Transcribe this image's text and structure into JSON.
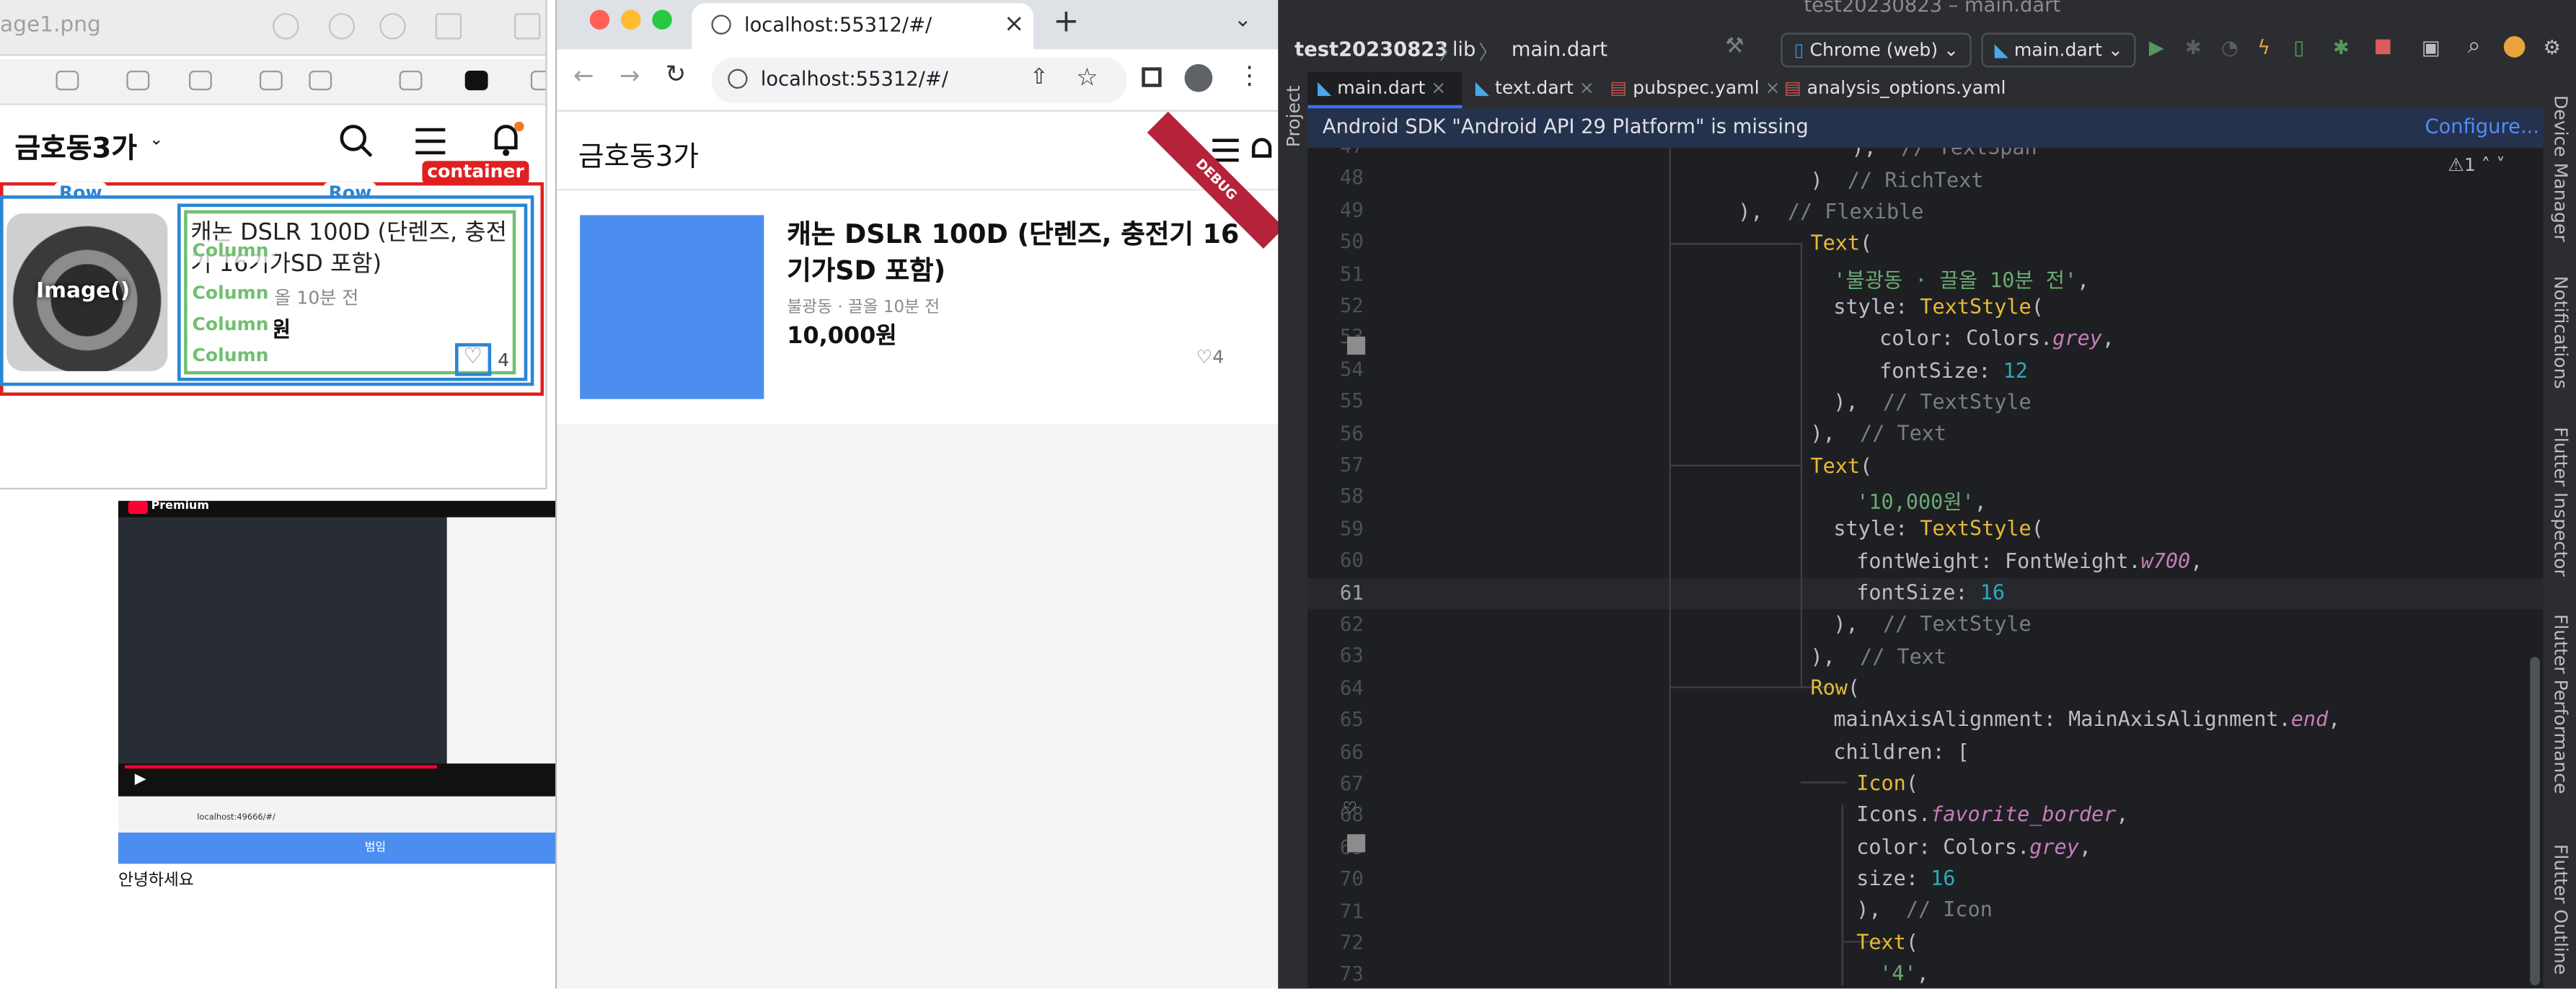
{
  "preview": {
    "filename": "age1.png",
    "app": {
      "title": "금호동3가",
      "product_title": "캐논 DSLR 100D (단렌즈, 충전기 16기가SD 포함)",
      "meta": "불광동 · 끌올 10분 전",
      "price": "원",
      "likes": "4"
    },
    "labels": {
      "container": "container",
      "row1": "Row",
      "row2": "Row",
      "image": "Image()",
      "column": "Column"
    }
  },
  "youtube": {
    "brand": "Premium",
    "greeting": "안녕하세요",
    "button": "범임",
    "url": "localhost:49666/#/"
  },
  "chrome": {
    "tab_title": "localhost:55312/#/",
    "url": "localhost:55312/#/",
    "app": {
      "title": "금호동3가",
      "product_title": "캐논 DSLR 100D (단렌즈, 충전기 16기가SD 포함)",
      "meta": "불광동 · 끌올 10분 전",
      "price": "10,000원",
      "likes": "4"
    },
    "debug_banner": "DEBUG"
  },
  "ide": {
    "window_title": "test20230823 – main.dart",
    "breadcrumb": [
      "test20230823",
      "lib",
      "main.dart"
    ],
    "device": "Chrome (web)",
    "run_config": "main.dart",
    "tabs": [
      "main.dart",
      "text.dart",
      "pubspec.yaml",
      "analysis_options.yaml"
    ],
    "notice": "Android SDK \"Android API 29 Platform\" is missing",
    "notice_action": "Configure...",
    "problems": "1",
    "right_tools": [
      "Device Manager",
      "Notifications",
      "Flutter Inspector",
      "Flutter Performance",
      "Flutter Outline"
    ],
    "left_tools": [
      "Project"
    ],
    "current_line": 61,
    "line_numbers": [
      "47",
      "48",
      "49",
      "50",
      "51",
      "52",
      "53",
      "54",
      "55",
      "56",
      "57",
      "58",
      "59",
      "60",
      "61",
      "62",
      "63",
      "64",
      "65",
      "66",
      "67",
      "68",
      "69",
      "70",
      "71",
      "72",
      "73"
    ]
  },
  "colors": {
    "accent_blue": "#4b8ef0",
    "debug_red": "#b5223a",
    "ide_bg": "#1e1f22",
    "annot_red": "#e02020",
    "annot_blue": "#2a86d6",
    "annot_green": "#70c070"
  }
}
